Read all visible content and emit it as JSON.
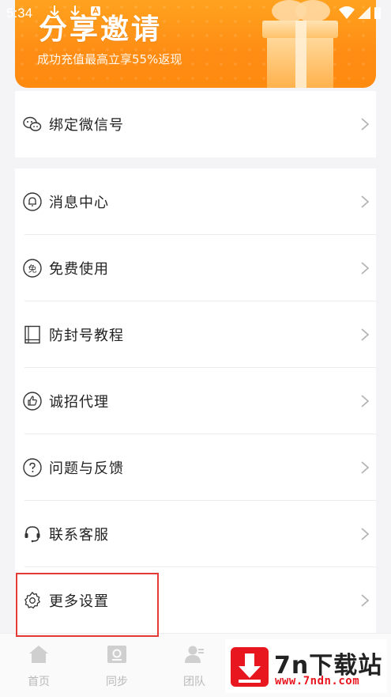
{
  "status_bar": {
    "time": "5:34"
  },
  "banner": {
    "title": "分享邀请",
    "subtitle": "成功充值最高立享55%返现"
  },
  "wechat_card": {
    "items": [
      {
        "label": "绑定微信号",
        "icon": "wechat-icon"
      }
    ]
  },
  "menu_card": {
    "items": [
      {
        "label": "消息中心",
        "icon": "bell-icon"
      },
      {
        "label": "免费使用",
        "icon": "free-icon"
      },
      {
        "label": "防封号教程",
        "icon": "book-icon"
      },
      {
        "label": "诚招代理",
        "icon": "thumbs-up-icon"
      },
      {
        "label": "问题与反馈",
        "icon": "question-icon"
      },
      {
        "label": "联系客服",
        "icon": "headset-icon"
      },
      {
        "label": "更多设置",
        "icon": "gear-icon"
      }
    ]
  },
  "bottom_nav": {
    "items": [
      {
        "label": "首页",
        "icon": "home-icon"
      },
      {
        "label": "同步",
        "icon": "sync-icon"
      },
      {
        "label": "团队",
        "icon": "team-icon"
      }
    ]
  },
  "watermark": {
    "title": "7n下载站",
    "url": "www.7ndn.com"
  },
  "colors": {
    "banner_orange": "#ff8d14",
    "highlight_red": "#e53935",
    "watermark_red": "#e8161e"
  }
}
